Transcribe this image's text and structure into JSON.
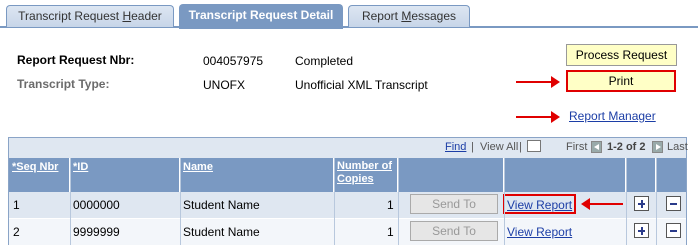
{
  "tabs": [
    {
      "pre": "Transcript Request ",
      "ul": "H",
      "post": "eader"
    },
    {
      "pre": "Transcript Request Detail",
      "ul": "",
      "post": ""
    },
    {
      "pre": "Report ",
      "ul": "M",
      "post": "essages"
    }
  ],
  "info": {
    "req_label": "Report Request Nbr:",
    "req_value": "004057975",
    "req_status": "Completed",
    "type_label": "Transcript Type:",
    "type_code": "UNOFX",
    "type_desc": "Unofficial XML Transcript"
  },
  "buttons": {
    "process": "Process Request",
    "print": "Print",
    "report_manager": "Report Manager"
  },
  "grid": {
    "find": "Find",
    "sep": "|",
    "view_all": "View All",
    "first": "First",
    "range": "1-2 of 2",
    "last": "Last",
    "headers": [
      "*Seq Nbr",
      "*ID",
      "Name",
      "Number of Copies"
    ],
    "rows": [
      {
        "seq": "1",
        "id": "0000000",
        "name": "Student Name",
        "copies": "1",
        "send": "Send To",
        "view": "View Report"
      },
      {
        "seq": "2",
        "id": "9999999",
        "name": "Student Name",
        "copies": "1",
        "send": "Send To",
        "view": "View Report"
      }
    ]
  },
  "colors": {
    "accent": "#7a99c2",
    "highlight": "#e00000",
    "button_bg": "#ffffc6"
  }
}
